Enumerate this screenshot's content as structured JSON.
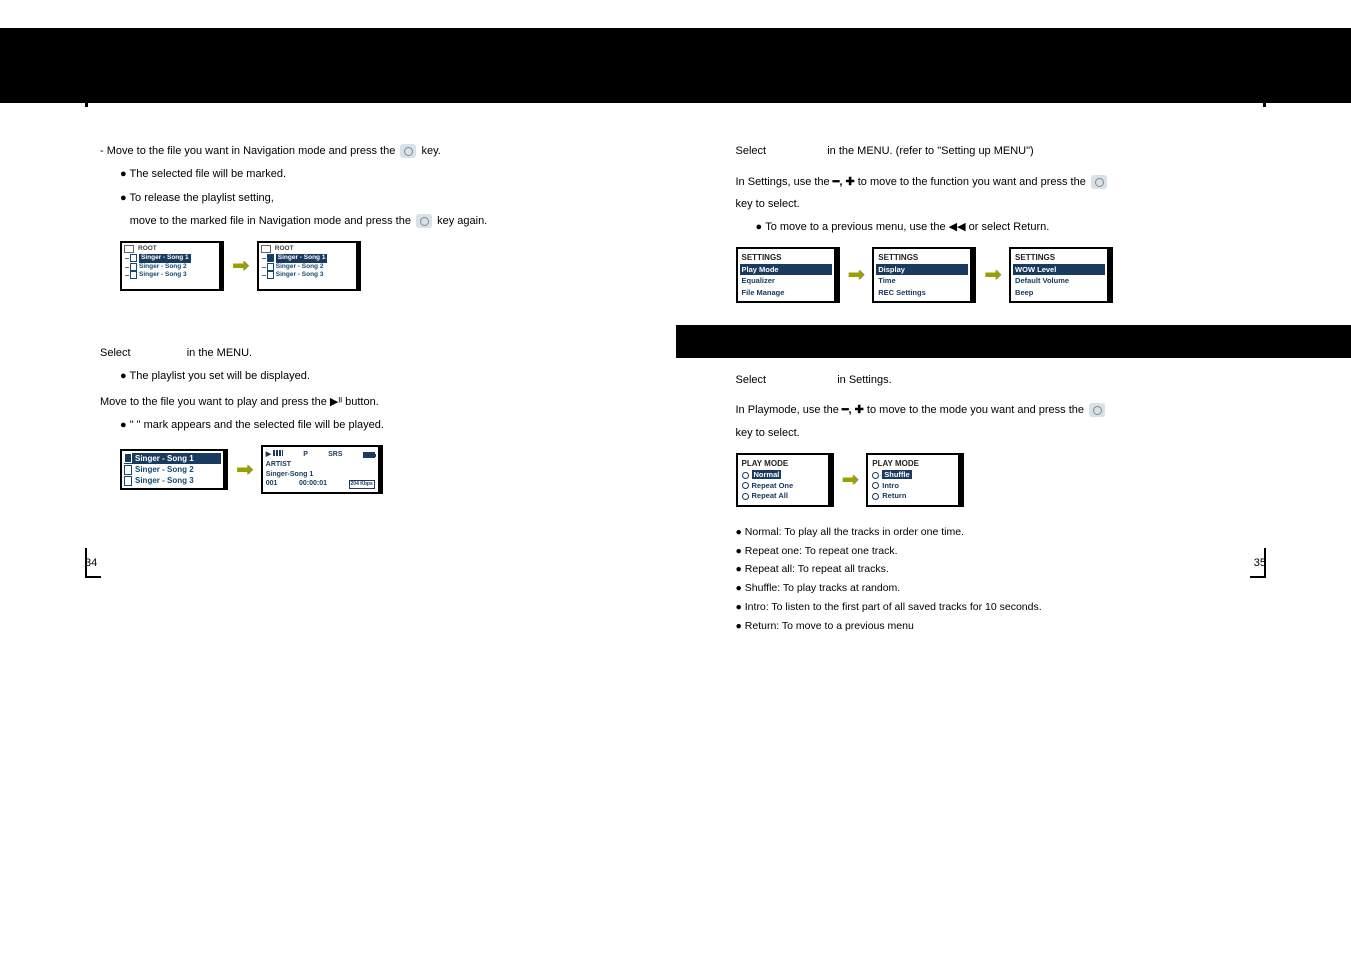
{
  "left": {
    "step3_text_a": "- Move to the file you want in Navigation mode and press the",
    "step3_text_b": "key.",
    "step3_note": "The selected file will be marked.",
    "step3_release1": "To release the playlist setting,",
    "step3_release2": "move to the marked file in Navigation mode and press the",
    "step3_release3": "key again.",
    "root_label": "ROOT",
    "songs": [
      "Singer - Song 1",
      "Singer - Song 2",
      "Singer - Song 3"
    ],
    "playing_step_a": "Select",
    "playing_step_b": "in the MENU.",
    "playing_note": "The playlist you set will be displayed.",
    "play_step2": "Move to the file you want to play and press the ▶ᴵᴵ button.",
    "play_step2_note": "\"    \" mark appears and the selected file will be played.",
    "np_mode": "P",
    "np_srs": "SRS",
    "np_artist_label": "ARTIST",
    "np_artist": "Singer-Song 1",
    "np_track": "001",
    "np_time": "00:00:01",
    "np_kbps": "204\nKbps",
    "page_num": "34"
  },
  "right": {
    "top_select_a": "Select",
    "top_select_b": "in the MENU. (refer to \"Setting up MENU\")",
    "step2_a": "In Settings, use the",
    "step2_b": "to move to the function you want and press the",
    "step2_c": "key to select.",
    "step2_note": "To move to a previous menu, use the   ◀◀  or select Return.",
    "settings_title": "SETTINGS",
    "settings1": [
      "Play Mode",
      "Equalizer",
      "File Manage"
    ],
    "settings2": [
      "Display",
      "Time",
      "REC Settings"
    ],
    "settings3": [
      "WOW Level",
      "Default Volume",
      "Beep"
    ],
    "pm_sel_a": "Select",
    "pm_sel_b": "in Settings.",
    "pm_step_a": "In Playmode, use the",
    "pm_step_b": "to move to the mode you want and press the",
    "pm_step_c": "key to select.",
    "pm_title": "PLAY MODE",
    "pm1": [
      "Normal",
      "Repeat One",
      "Repeat All"
    ],
    "pm2": [
      "Shuffle",
      "Intro",
      "Return"
    ],
    "desc": [
      "Normal: To play all the tracks in order one time.",
      "Repeat one: To repeat one track.",
      "Repeat all: To repeat all tracks.",
      "Shuffle: To play tracks at random.",
      "Intro: To listen to the first part of all saved tracks for 10 seconds.",
      "Return: To move to a previous menu"
    ],
    "page_num": "35"
  }
}
